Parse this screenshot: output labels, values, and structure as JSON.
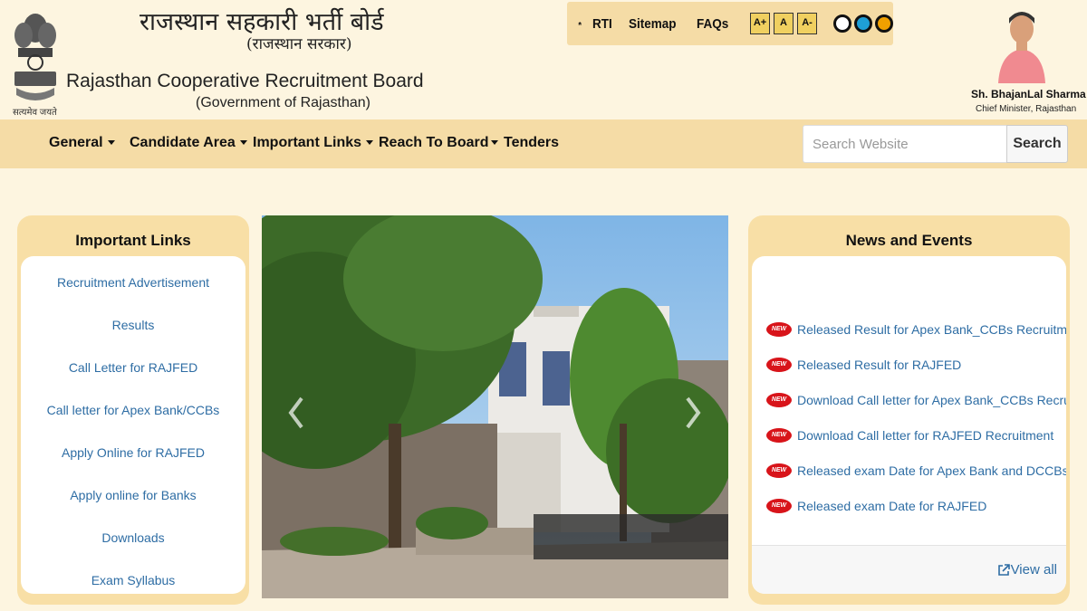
{
  "header": {
    "title_hindi": "राजस्थान सहकारी भर्ती बोर्ड",
    "subtitle_hindi": "(राजस्थान सरकार)",
    "title_english": "Rajasthan Cooperative Recruitment Board",
    "subtitle_english": "(Government of Rajasthan)",
    "emblem_motto": "सत्यमेव जयते"
  },
  "topbar": {
    "links": [
      "RTI",
      "Sitemap",
      "FAQs"
    ],
    "font_buttons": [
      "A+",
      "A",
      "A-"
    ]
  },
  "cm": {
    "name": "Sh. BhajanLal Sharma",
    "title": "Chief Minister, Rajasthan"
  },
  "nav": {
    "items": [
      "General",
      "Candidate Area",
      "Important Links",
      "Reach To Board",
      "Tenders"
    ],
    "search_placeholder": "Search Website",
    "search_button": "Search"
  },
  "important_links": {
    "title": "Important Links",
    "items": [
      "Recruitment Advertisement",
      "Results",
      "Call Letter for RAJFED",
      "Call letter for Apex Bank/CCBs",
      "Apply Online for RAJFED",
      "Apply online for Banks",
      "Downloads",
      "Exam Syllabus"
    ]
  },
  "news": {
    "title": "News and Events",
    "badge": "NEW",
    "items": [
      "Released Result for Apex Bank_CCBs Recruitment",
      "Released Result for RAJFED",
      "Download Call letter for Apex Bank_CCBs Recruitment",
      "Download Call letter for RAJFED Recruitment",
      "Released exam Date for Apex Bank and DCCBs",
      "Released exam Date for RAJFED"
    ],
    "view_all": "View all"
  },
  "colors": {
    "page_bg": "#fdf5e0",
    "bar_bg": "#f5dca6",
    "link": "#2e6da4",
    "badge_red": "#d8141a"
  }
}
